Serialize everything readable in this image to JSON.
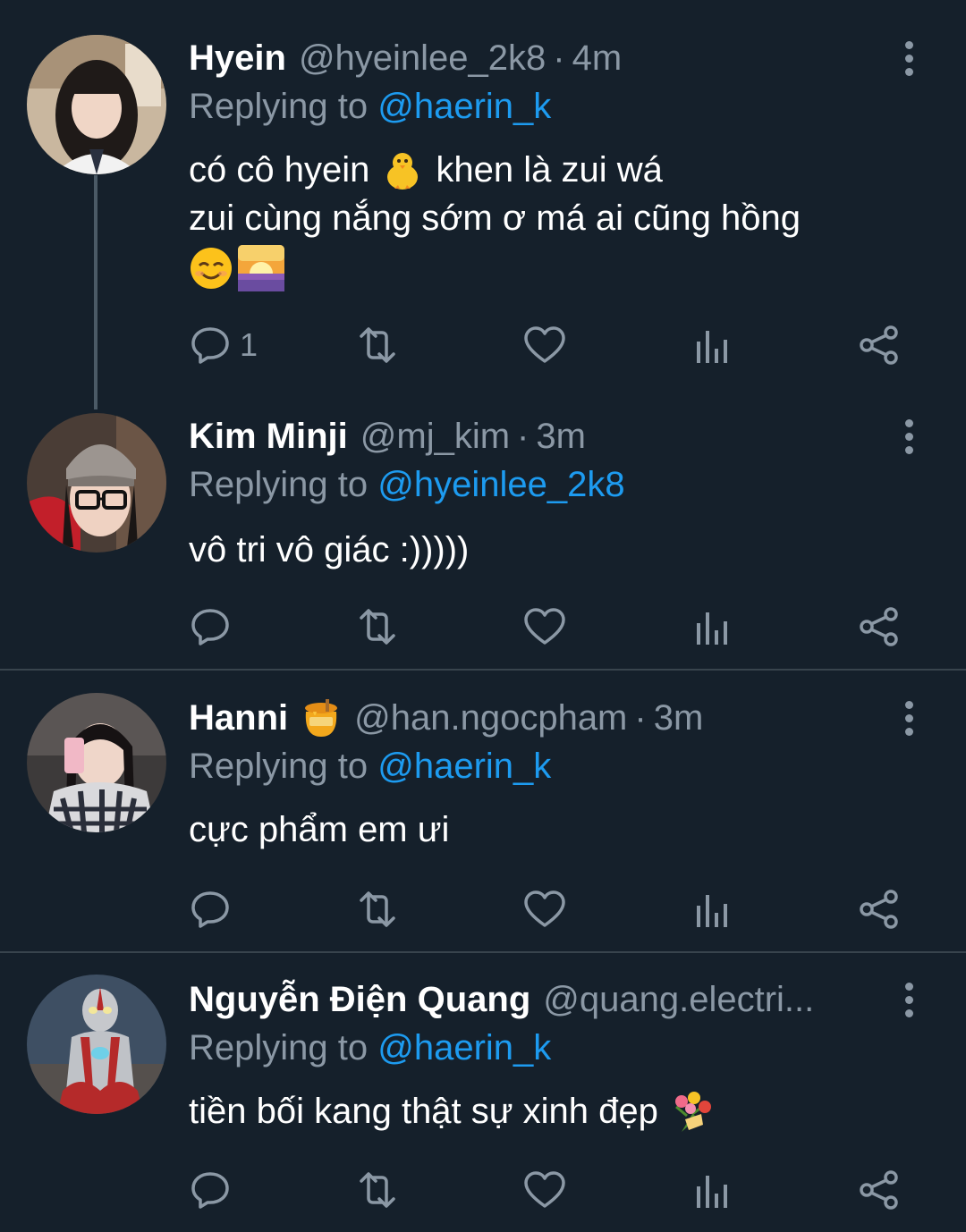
{
  "tweets": [
    {
      "name": "Hyein",
      "handle": "@hyeinlee_2k8",
      "time": "4m",
      "replying_prefix": "Replying to",
      "replying_to": "@haerin_k",
      "text_line1_a": "có cô hyein",
      "text_line1_b": "khen là zui wá",
      "text_line2": "zui cùng nắng sớm ơ má ai cũng hồng",
      "emojis": [
        "baby-chick-emoji",
        "smiling-face-emoji",
        "sunrise-emoji"
      ],
      "reply_count": "1"
    },
    {
      "name": "Kim Minji",
      "handle": "@mj_kim",
      "time": "3m",
      "replying_prefix": "Replying to",
      "replying_to": "@hyeinlee_2k8",
      "text": "vô tri vô giác :)))))",
      "reply_count": ""
    },
    {
      "name": "Hanni",
      "name_emoji": "honey-pot-emoji",
      "handle": "@han.ngocpham",
      "time": "3m",
      "replying_prefix": "Replying to",
      "replying_to": "@haerin_k",
      "text": "cực phẩm em ưi",
      "reply_count": ""
    },
    {
      "name": "Nguyễn Điện Quang",
      "handle": "@quang.electri...",
      "replying_prefix": "Replying to",
      "replying_to": "@haerin_k",
      "text": "tiền bối kang thật sự xinh đẹp",
      "text_emoji": "bouquet-emoji",
      "reply_count": ""
    }
  ],
  "separator": "·",
  "colors": {
    "background": "#15202b",
    "secondary_text": "#8b98a5",
    "link": "#1d9bf0",
    "divider": "#38444d"
  },
  "icons": [
    "reply-icon",
    "retweet-icon",
    "like-icon",
    "views-icon",
    "share-icon",
    "more-icon"
  ]
}
